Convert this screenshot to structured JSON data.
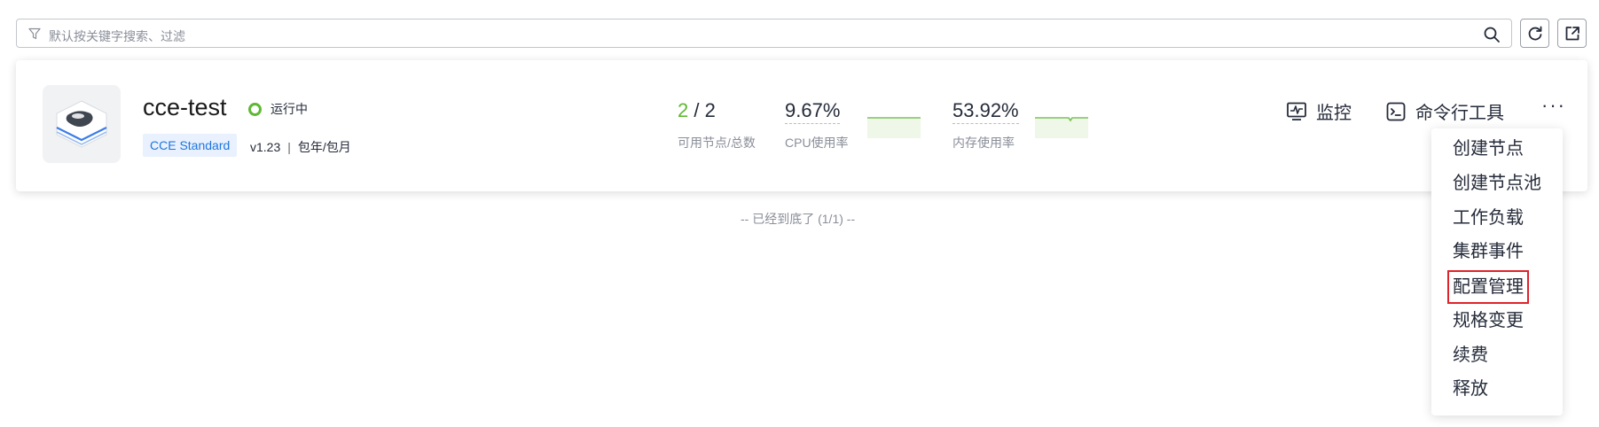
{
  "search": {
    "placeholder": "默认按关键字搜索、过滤"
  },
  "cluster": {
    "name": "cce-test",
    "status": "运行中",
    "status_color": "#5fb833",
    "edition_tag": "CCE Standard",
    "version": "v1.23",
    "separator": "|",
    "billing": "包年/包月",
    "nodes": {
      "available": "2",
      "slash": " / ",
      "total": "2",
      "label": "可用节点/总数"
    },
    "cpu": {
      "value": "9.67%",
      "label": "CPU使用率"
    },
    "memory": {
      "value": "53.92%",
      "label": "内存使用率"
    }
  },
  "actions": {
    "monitor": "监控",
    "cli": "命令行工具",
    "more": "···"
  },
  "footer_note": "-- 已经到底了 (1/1) --",
  "menu": {
    "items": [
      "创建节点",
      "创建节点池",
      "工作负载",
      "集群事件",
      "配置管理",
      "规格变更",
      "续费",
      "释放"
    ],
    "highlighted": "配置管理",
    "highlight_color": "#e0232b"
  },
  "icons": {
    "filter": "filter-icon",
    "search": "search-icon",
    "refresh": "refresh-icon",
    "export": "export-icon",
    "monitor": "monitor-icon",
    "terminal": "terminal-icon",
    "cluster": "cluster-icon"
  }
}
